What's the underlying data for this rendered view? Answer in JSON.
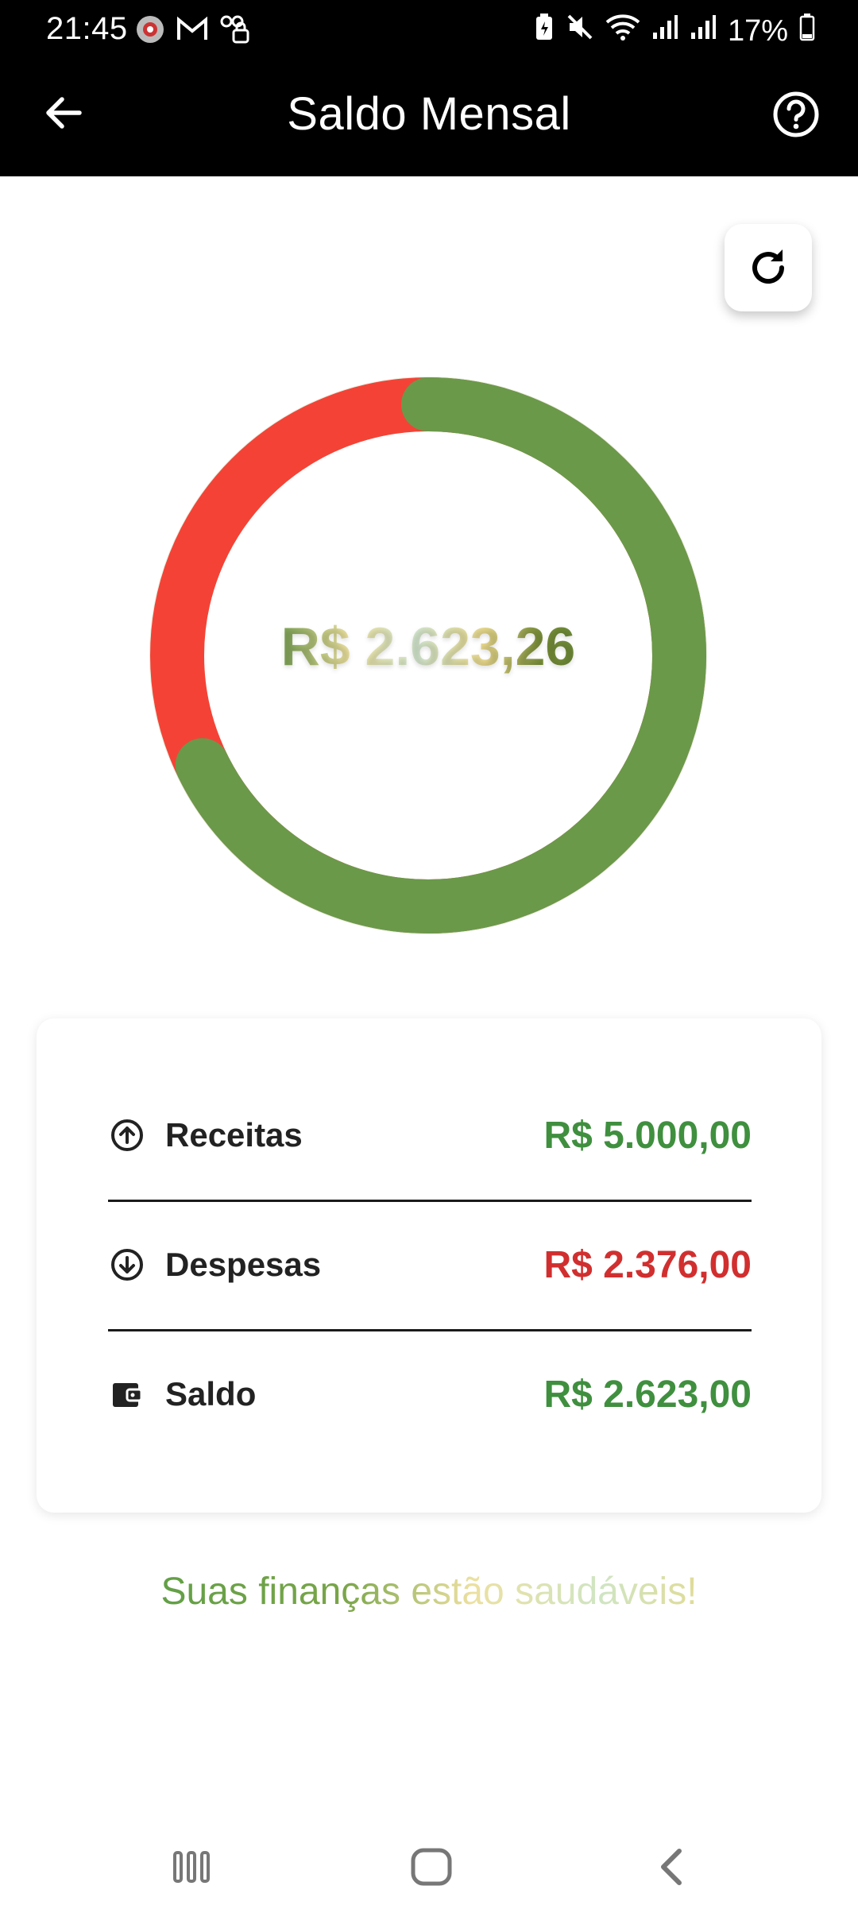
{
  "status_bar": {
    "time": "21:45",
    "battery": "17%",
    "left_icons": [
      "app-icon",
      "gmail-icon",
      "voicemail-icon"
    ],
    "right_icons": [
      "battery-saver-icon",
      "mute-icon",
      "wifi-icon",
      "signal-icon",
      "signal-icon"
    ]
  },
  "app_bar": {
    "title": "Saldo Mensal",
    "back_icon": "arrow-left-icon",
    "help_icon": "help-circle-icon"
  },
  "refresh": {
    "icon": "refresh-icon"
  },
  "chart_data": {
    "type": "pie",
    "style": "donut",
    "center_label": "R$ 2.623,26",
    "slices": [
      {
        "label": "Receitas",
        "value": 5000.0,
        "color": "#6a994a"
      },
      {
        "label": "Despesas",
        "value": 2376.0,
        "color": "#f44336"
      }
    ]
  },
  "summary": {
    "rows": [
      {
        "icon": "arrow-up-circle-icon",
        "label": "Receitas",
        "value": "R$ 5.000,00",
        "color": "#3f8f3f"
      },
      {
        "icon": "arrow-down-circle-icon",
        "label": "Despesas",
        "value": "R$ 2.376,00",
        "color": "#d12f2f"
      },
      {
        "icon": "wallet-icon",
        "label": "Saldo",
        "value": "R$ 2.623,00",
        "color": "#3f8f3f"
      }
    ]
  },
  "status_message": "Suas finanças estão saudáveis!",
  "nav": {
    "recents_icon": "recents-icon",
    "home_icon": "home-icon",
    "back_icon": "back-nav-icon"
  }
}
